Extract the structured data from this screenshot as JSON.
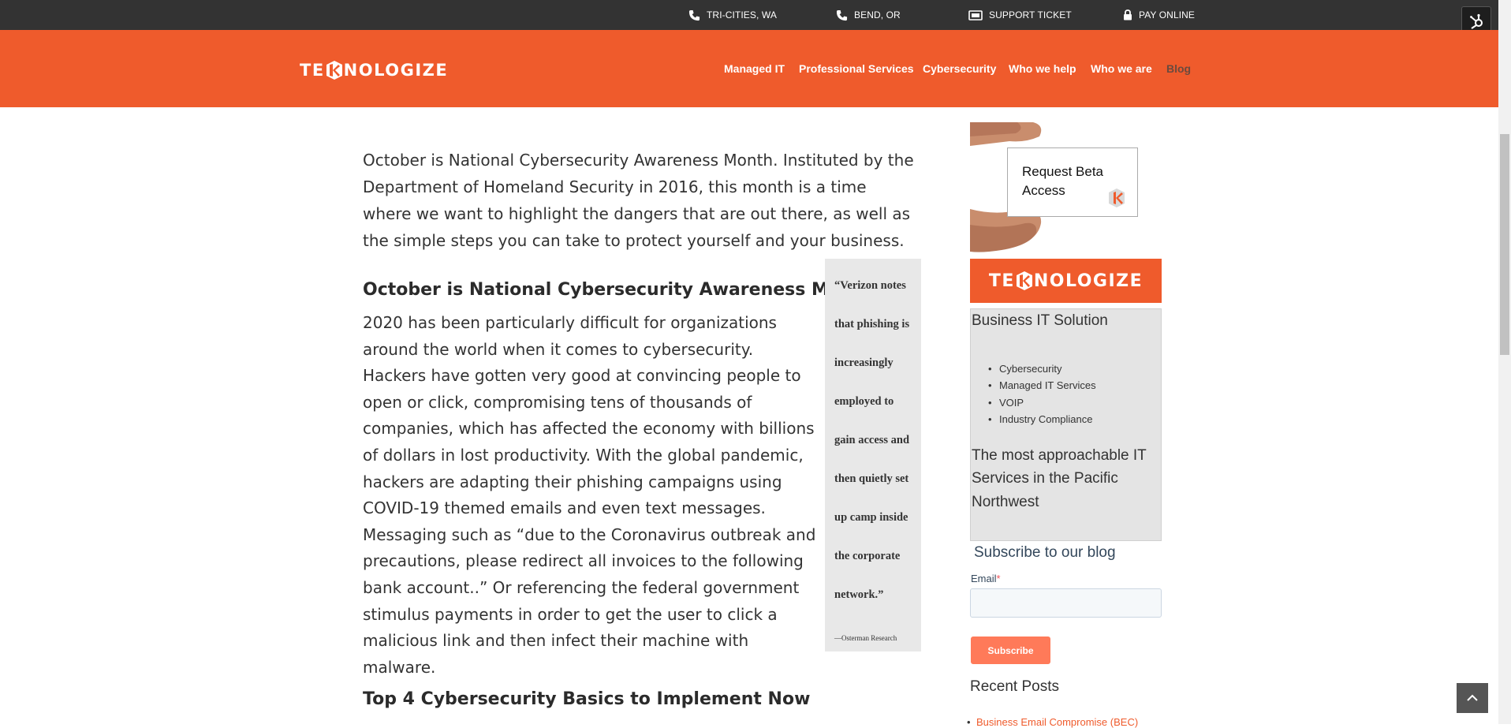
{
  "topbar": {
    "items": [
      {
        "label": "TRI-CITIES, WA",
        "icon": "phone-icon"
      },
      {
        "label": "BEND, OR",
        "icon": "phone-icon"
      },
      {
        "label": "SUPPORT TICKET",
        "icon": "ticket-icon"
      },
      {
        "label": "PAY ONLINE",
        "icon": "lock-icon"
      }
    ]
  },
  "brand": {
    "logo_text_left": "TE",
    "logo_text_right": "NOLOGIZE",
    "accent": "#ef5b2c"
  },
  "nav": {
    "items": [
      {
        "label": "Managed IT"
      },
      {
        "label": "Professional Services"
      },
      {
        "label": "Cybersecurity"
      },
      {
        "label": "Who we help"
      },
      {
        "label": "Who we are"
      },
      {
        "label": "Blog"
      }
    ]
  },
  "article": {
    "intro": "October is National Cybersecurity Awareness Month. Instituted by the Department of Homeland Security in 2016, this month is a time where we want to highlight the dangers that are out there, as well as the simple steps you can take to protect yourself and your business.",
    "heading1": "October is National Cybersecurity Awareness Month",
    "body1": "2020 has been particularly difficult for organizations around the world when it comes to cybersecurity. Hackers have gotten very good at convincing people to open or click, compromising tens of thousands of companies, which has affected the economy with billions of dollars in lost productivity. With the global pandemic, hackers are adapting their phishing campaigns using COVID-19 themed emails and even text messages. Messaging such as “due to the Coronavirus outbreak and precautions, please redirect all invoices to the following bank account..” Or referencing the federal government stimulus payments in order to get the user to click a malicious link and then infect their machine with malware.",
    "heading2": "Top 4 Cybersecurity Basics to Implement Now",
    "quote": "“Verizon notes that phishing is increasingly employed to gain access and then quietly set up camp inside the corporate network.”",
    "quote_cite": "—Osterman Research"
  },
  "sidebar": {
    "ad_text": "Request Beta Access",
    "biz_title": "Business IT Solution",
    "biz_items": [
      "Cybersecurity",
      "Managed IT Services",
      "VOIP",
      "Industry Compliance"
    ],
    "biz_tagline": "The most approachable IT Services in the Pacific Northwest",
    "subscribe_title": "Subscribe to our blog",
    "email_label": "Email",
    "email_required": "*",
    "email_value": "",
    "subscribe_button": "Subscribe",
    "recent_title": "Recent Posts",
    "recent_first": "Business Email Compromise (BEC)"
  }
}
